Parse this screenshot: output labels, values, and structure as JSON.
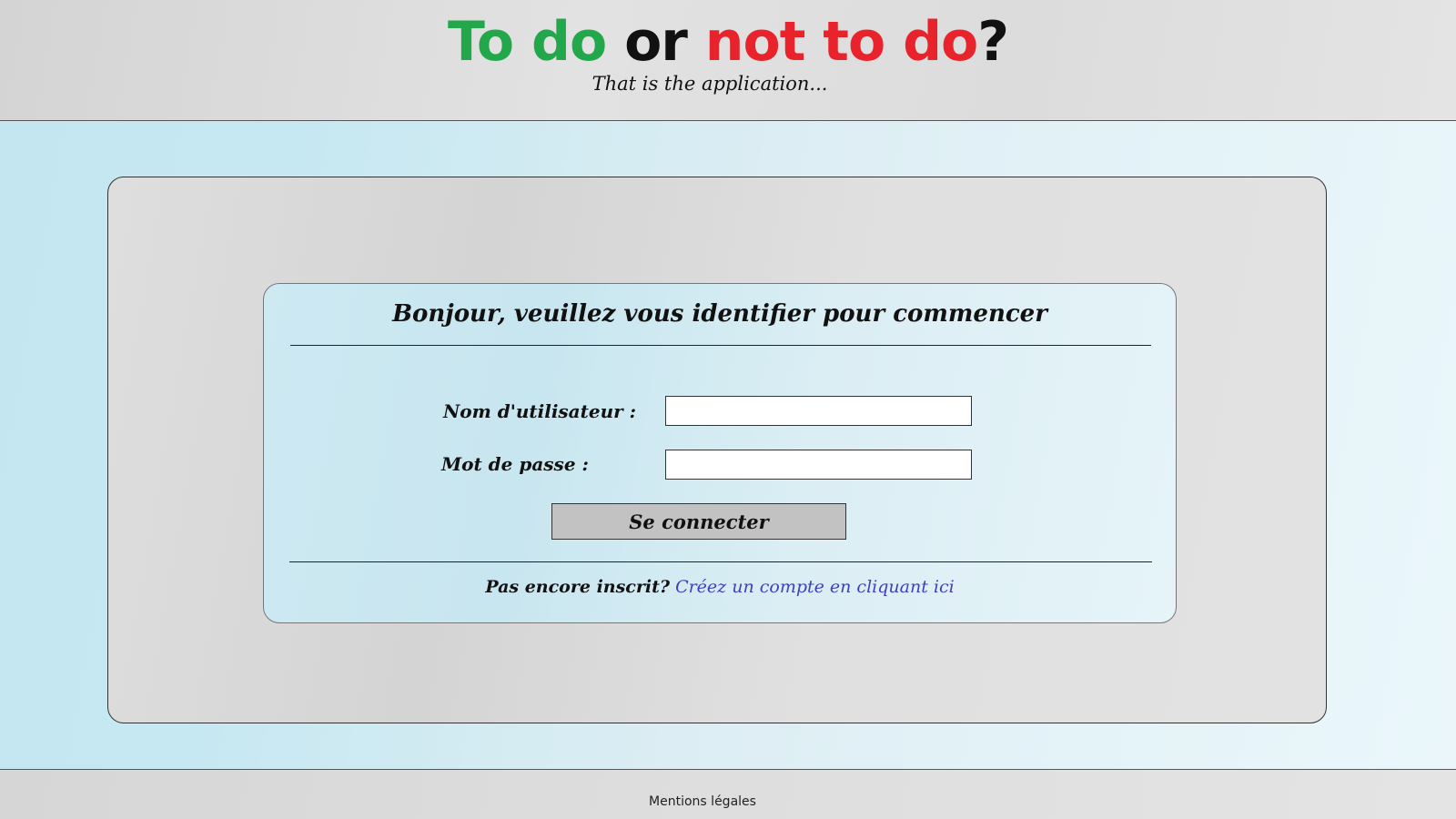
{
  "header": {
    "title": {
      "part1": "To do",
      "part2": " or ",
      "part3": "not to do",
      "part4": "?"
    },
    "tagline": "That is the application..."
  },
  "login": {
    "heading": "Bonjour, veuillez vous identifier pour commencer",
    "username_label": "Nom d'utilisateur :",
    "username_value": "",
    "password_label": "Mot de passe :",
    "password_value": "",
    "submit_label": "Se connecter",
    "signup_prompt": "Pas encore inscrit?",
    "signup_link": "Créez un compte en cliquant ici"
  },
  "footer": {
    "legal_link": "Mentions légales"
  },
  "colors": {
    "title_green": "#22a84a",
    "title_red": "#e8232b",
    "link_blue": "#3f3fbf",
    "button_gray": "#c2c2c2"
  }
}
